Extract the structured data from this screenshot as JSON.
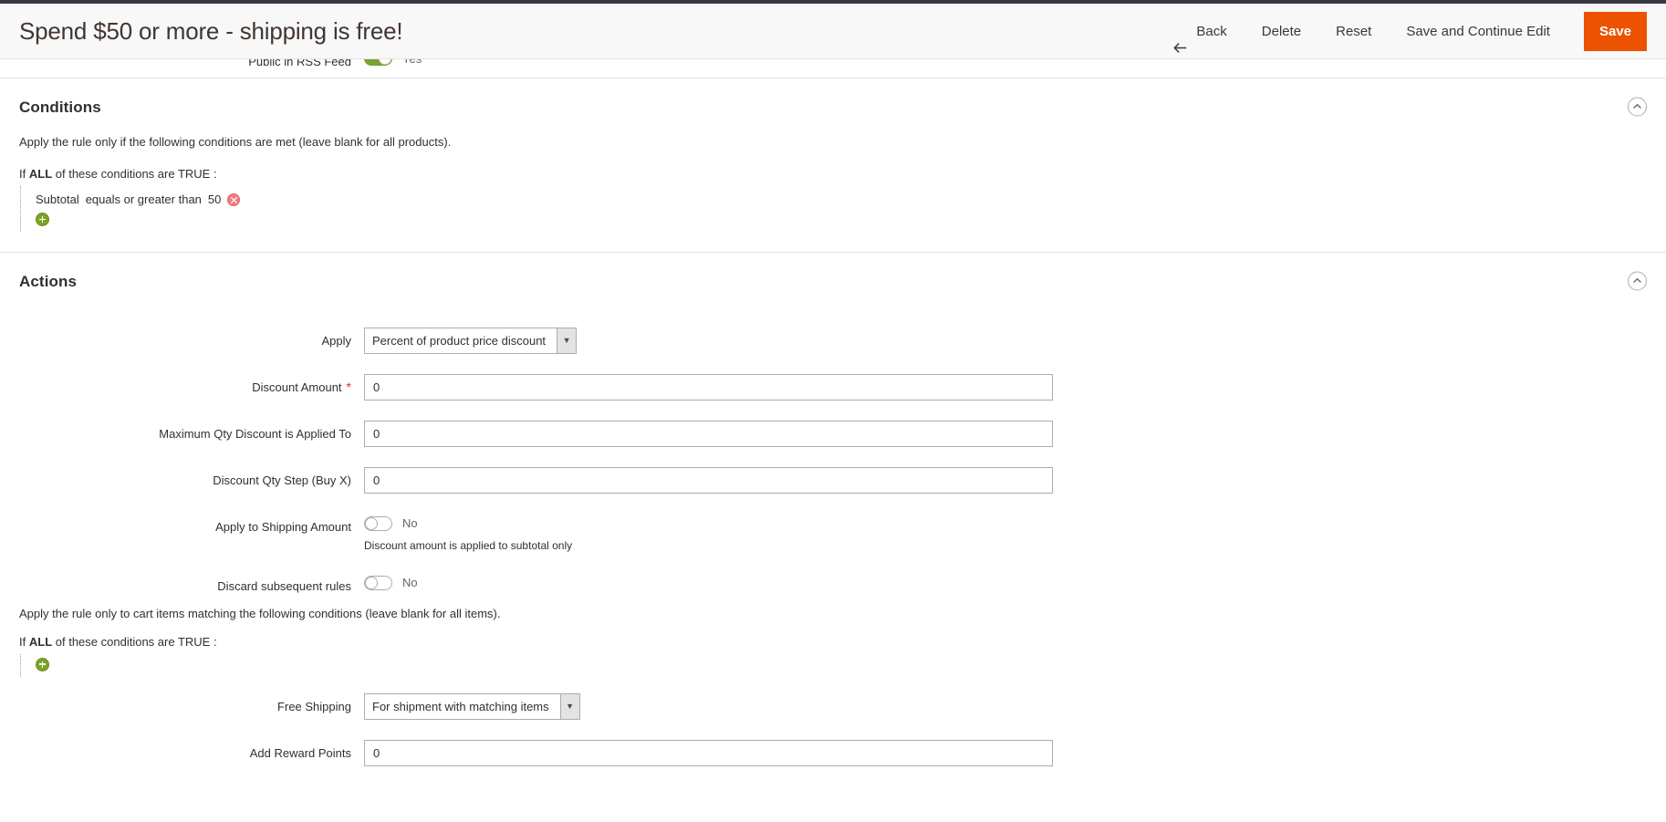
{
  "header": {
    "title": "Spend $50 or more - shipping is free!",
    "back_label": "Back",
    "delete_label": "Delete",
    "reset_label": "Reset",
    "save_continue_label": "Save and Continue Edit",
    "save_label": "Save",
    "back_icon": "arrow-left-icon",
    "save_color": "#eb5202"
  },
  "cut_row": {
    "label": "Public in RSS Feed",
    "toggle_state": "on",
    "toggle_value": "Yes",
    "toggle_color": "#79a22e"
  },
  "conditions": {
    "title": "Conditions",
    "collapse_icon": "chevron-up-circle-icon",
    "description": "Apply the rule only if the following conditions are met (leave blank for all products).",
    "lead_prefix": "If",
    "lead_aggregator": "ALL",
    "lead_suffix": "of these conditions are TRUE :",
    "rows": [
      {
        "attribute": "Subtotal",
        "operator": "equals or greater than",
        "value": "50",
        "remove_icon": "remove-circle-icon"
      }
    ],
    "add_icon": "add-circle-icon"
  },
  "actions": {
    "title": "Actions",
    "collapse_icon": "chevron-up-circle-icon",
    "apply": {
      "label": "Apply",
      "value": "Percent of product price discount",
      "arrow_icon": "chevron-down-icon"
    },
    "discount_amount": {
      "label": "Discount Amount",
      "required": "*",
      "value": "0"
    },
    "max_qty": {
      "label": "Maximum Qty Discount is Applied To",
      "value": "0"
    },
    "qty_step": {
      "label": "Discount Qty Step (Buy X)",
      "value": "0"
    },
    "apply_to_shipping": {
      "label": "Apply to Shipping Amount",
      "toggle_state": "off",
      "toggle_value": "No",
      "note": "Discount amount is applied to subtotal only"
    },
    "discard_subsequent": {
      "label": "Discard subsequent rules",
      "toggle_state": "off",
      "toggle_value": "No"
    },
    "cart_item_conditions": {
      "description": "Apply the rule only to cart items matching the following conditions (leave blank for all items).",
      "lead_prefix": "If",
      "lead_aggregator": "ALL",
      "lead_suffix": "of these conditions are TRUE :",
      "add_icon": "add-circle-icon"
    },
    "free_shipping": {
      "label": "Free Shipping",
      "value": "For shipment with matching items",
      "arrow_icon": "chevron-down-icon"
    },
    "reward_points": {
      "label": "Add Reward Points",
      "value": "0"
    }
  }
}
